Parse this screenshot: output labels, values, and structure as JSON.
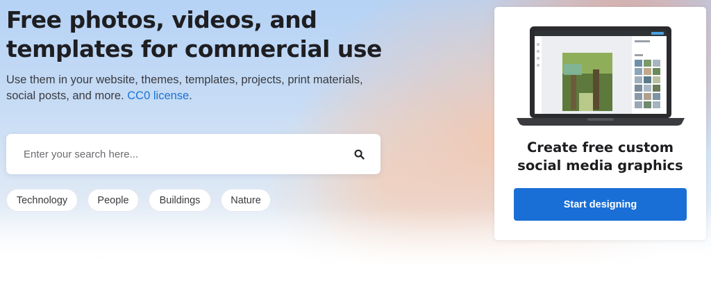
{
  "hero": {
    "headline_line1": "Free photos, videos, and",
    "headline_line2": "templates for commercial use",
    "subline_text": "Use them in your website, themes, templates, projects, print materials, social posts, and more.",
    "license_link": "CC0 license",
    "subline_end": "."
  },
  "search": {
    "placeholder": "Enter your search here...",
    "icon": "search-icon"
  },
  "tags": [
    "Technology",
    "People",
    "Buildings",
    "Nature"
  ],
  "promo": {
    "title_line1": "Create free custom",
    "title_line2": "social media graphics",
    "button_label": "Start designing",
    "accent_color": "#1a6fd6"
  },
  "colors": {
    "link": "#1a73d4"
  }
}
